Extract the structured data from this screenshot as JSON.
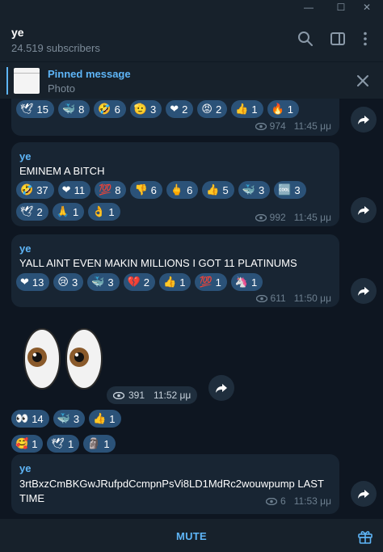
{
  "window": {
    "min": "—",
    "max": "☐",
    "close": "✕"
  },
  "header": {
    "title": "ye",
    "subtitle": "24.519 subscribers",
    "icons": [
      "search-icon",
      "sidebar-icon",
      "more-icon"
    ]
  },
  "pinned": {
    "title": "Pinned message",
    "subtitle": "Photo"
  },
  "messages": [
    {
      "sender": "",
      "text": "",
      "reactions": [
        {
          "emoji": "🕊",
          "count": "15"
        },
        {
          "emoji": "🐳",
          "count": "8"
        },
        {
          "emoji": "🤣",
          "count": "6"
        },
        {
          "emoji": "🫡",
          "count": "3"
        },
        {
          "emoji": "❤",
          "count": "2"
        },
        {
          "emoji": "😡",
          "count": "2"
        },
        {
          "emoji": "👍",
          "count": "1"
        },
        {
          "emoji": "🔥",
          "count": "1"
        }
      ],
      "views": "974",
      "time": "11:45 μμ"
    },
    {
      "sender": "ye",
      "text": "EMINEM A BITCH",
      "reactions": [
        {
          "emoji": "🤣",
          "count": "37"
        },
        {
          "emoji": "❤",
          "count": "11"
        },
        {
          "emoji": "💯",
          "count": "8"
        },
        {
          "emoji": "👎",
          "count": "6"
        },
        {
          "emoji": "🖕",
          "count": "6"
        },
        {
          "emoji": "👍",
          "count": "5"
        },
        {
          "emoji": "🐳",
          "count": "3"
        },
        {
          "emoji": "🆒",
          "count": "3"
        },
        {
          "emoji": "🕊",
          "count": "2"
        },
        {
          "emoji": "🙏",
          "count": "1"
        },
        {
          "emoji": "👌",
          "count": "1"
        }
      ],
      "views": "992",
      "time": "11:45 μμ"
    },
    {
      "sender": "ye",
      "text": "YALL AINT EVEN MAKIN MILLIONS  I GOT 11 PLATINUMS",
      "reactions": [
        {
          "emoji": "❤",
          "count": "13"
        },
        {
          "emoji": "😢",
          "count": "3"
        },
        {
          "emoji": "🐳",
          "count": "3"
        },
        {
          "emoji": "💔",
          "count": "2"
        },
        {
          "emoji": "👍",
          "count": "1"
        },
        {
          "emoji": "💯",
          "count": "1"
        },
        {
          "emoji": "🦄",
          "count": "1"
        }
      ],
      "views": "611",
      "time": "11:50 μμ"
    },
    {
      "sender": "",
      "text": "",
      "sticker": "👀",
      "reactions": [
        {
          "emoji": "👀",
          "count": "14"
        },
        {
          "emoji": "🐳",
          "count": "3"
        },
        {
          "emoji": "👍",
          "count": "1"
        },
        {
          "emoji": "🥰",
          "count": "1"
        },
        {
          "emoji": "🕊",
          "count": "1"
        },
        {
          "emoji": "🗿",
          "count": "1"
        }
      ],
      "views": "391",
      "time": "11:52 μμ"
    },
    {
      "sender": "ye",
      "text": "3rtBxzCmBKGwJRufpdCcmpnPsVi8LD1MdRc2wouwpump  LAST",
      "text2": "TIME",
      "reactions": [],
      "views": "6",
      "time": "11:53 μμ"
    }
  ],
  "footer": {
    "mute_label": "MUTE"
  }
}
